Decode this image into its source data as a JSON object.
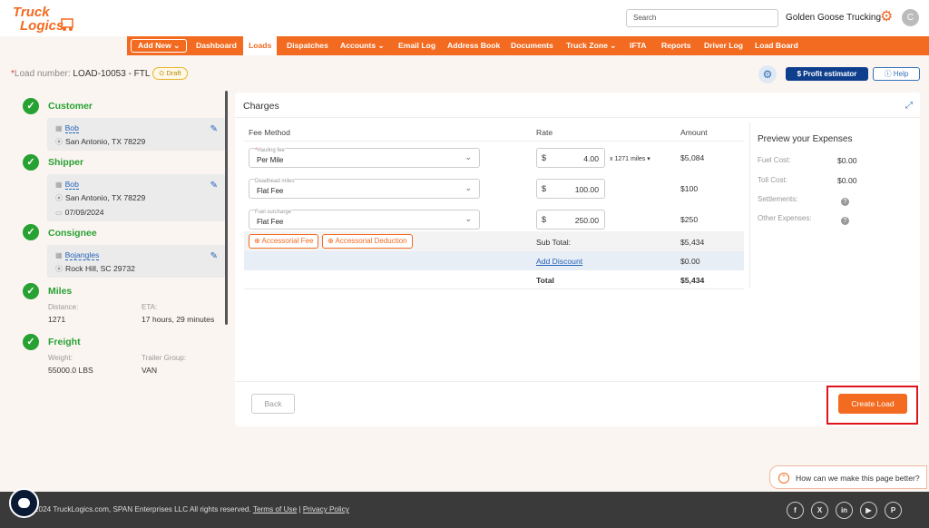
{
  "header": {
    "logo_text": "TruckLogics",
    "search_placeholder": "Search",
    "company": "Golden Goose Trucking",
    "avatar_initial": "C"
  },
  "nav": {
    "add_new": "Add New",
    "items": [
      "Dashboard",
      "Loads",
      "Dispatches",
      "Accounts",
      "Email Log",
      "Address Book",
      "Documents",
      "Truck Zone",
      "IFTA",
      "Reports",
      "Driver Log",
      "Load Board"
    ],
    "active": "Loads"
  },
  "load": {
    "label": "Load number:",
    "number": "LOAD-10053 - FTL",
    "status": "Draft"
  },
  "toolbar": {
    "profit_label": "Profit estimator",
    "help_label": "Help"
  },
  "sidebar": {
    "customer": {
      "title": "Customer",
      "name": "Bob",
      "location": "San Antonio, TX 78229"
    },
    "shipper": {
      "title": "Shipper",
      "name": "Bob",
      "location": "San Antonio, TX 78229",
      "date": "07/09/2024"
    },
    "consignee": {
      "title": "Consignee",
      "name": "Bojangles",
      "location": "Rock Hill, SC 29732"
    },
    "miles": {
      "title": "Miles",
      "distance_label": "Distance:",
      "distance": "1271",
      "eta_label": "ETA:",
      "eta": "17 hours, 29 minutes"
    },
    "freight": {
      "title": "Freight",
      "weight_label": "Weight:",
      "weight": "55000.0 LBS",
      "trailer_label": "Trailer Group:",
      "trailer": "VAN"
    }
  },
  "charges": {
    "title": "Charges",
    "headers": {
      "fee_method": "Fee Method",
      "rate": "Rate",
      "amount": "Amount"
    },
    "rows": [
      {
        "label": "Hauling fee",
        "value": "Per Mile",
        "rate": "4.00",
        "miles": "x 1271 miles",
        "amount": "$5,084"
      },
      {
        "label": "Deadhead miles",
        "value": "Flat Fee",
        "rate": "100.00",
        "amount": "$100"
      },
      {
        "label": "Fuel surcharge",
        "value": "Flat Fee",
        "rate": "250.00",
        "amount": "$250"
      }
    ],
    "accessorial_fee": "Accessorial Fee",
    "accessorial_deduction": "Accessorial Deduction",
    "subtotal_label": "Sub Total:",
    "subtotal": "$5,434",
    "discount_label": "Add Discount",
    "discount": "$0.00",
    "total_label": "Total",
    "total": "$5,434",
    "currency": "$"
  },
  "preview": {
    "title": "Preview your Expenses",
    "fuel_label": "Fuel Cost:",
    "fuel": "$0.00",
    "toll_label": "Toll Cost:",
    "toll": "$0.00",
    "settlements_label": "Settlements:",
    "other_label": "Other Expenses:"
  },
  "actions": {
    "back": "Back",
    "create": "Create Load"
  },
  "feedback": {
    "text": "How can we make this page better?"
  },
  "footer": {
    "copyright": "2024 TruckLogics.com, SPAN Enterprises LLC All rights reserved.",
    "terms": "Terms of Use",
    "separator": "|",
    "privacy": "Privacy Policy",
    "socials": [
      "f",
      "X",
      "in",
      "▶",
      "P"
    ]
  },
  "colors": {
    "brand": "#f26b21",
    "success": "#27a132",
    "link": "#2563b8",
    "primary_button": "#0f3f8c"
  }
}
